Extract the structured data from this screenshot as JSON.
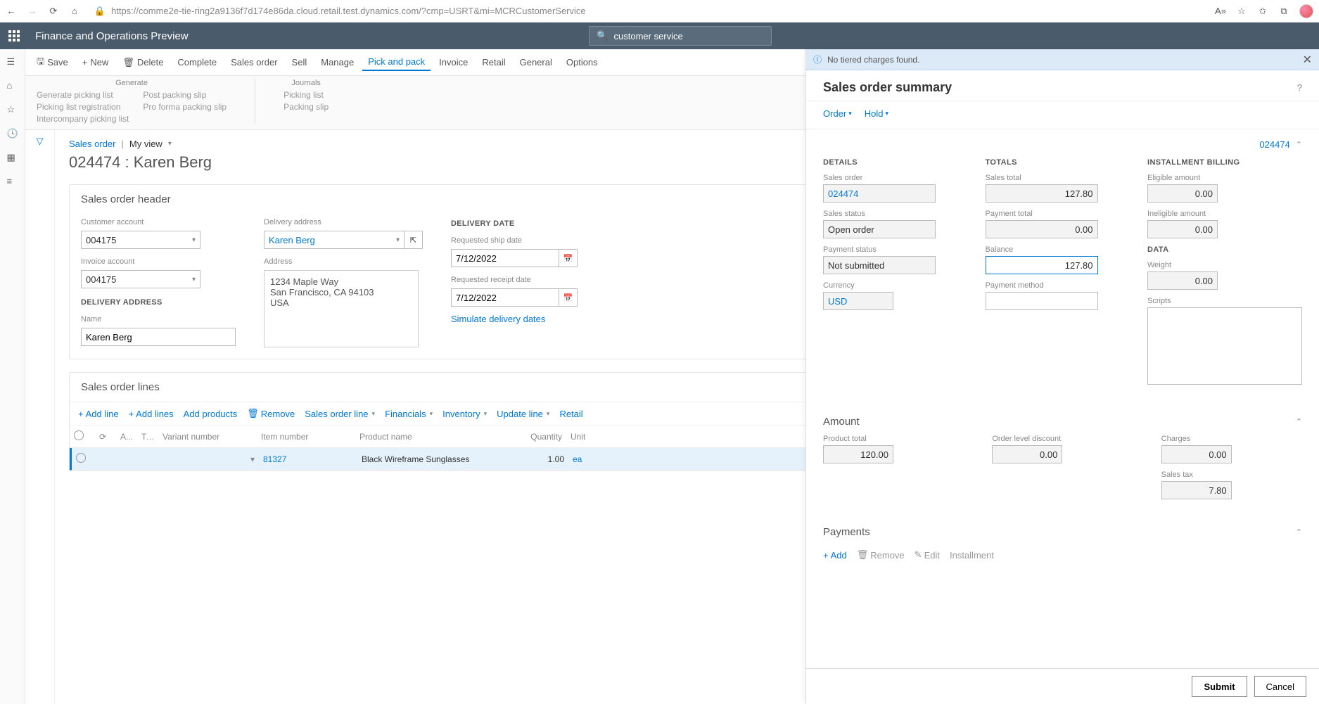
{
  "browser": {
    "url": "https://comme2e-tie-ring2a9136f7d174e86da.cloud.retail.test.dynamics.com/?cmp=USRT&mi=MCRCustomerService"
  },
  "header": {
    "app_title": "Finance and Operations Preview",
    "search_value": "customer service"
  },
  "toolbar": {
    "save": "Save",
    "new": "New",
    "delete": "Delete",
    "complete": "Complete",
    "sales_order": "Sales order",
    "sell": "Sell",
    "manage": "Manage",
    "pick_pack": "Pick and pack",
    "invoice": "Invoice",
    "retail": "Retail",
    "general": "General",
    "options": "Options"
  },
  "subtoolbar": {
    "generate": {
      "title": "Generate",
      "col1": [
        "Generate picking list",
        "Picking list registration",
        "Intercompany picking list"
      ],
      "col2": [
        "Post packing slip",
        "Pro forma packing slip"
      ]
    },
    "journals": {
      "title": "Journals",
      "items": [
        "Picking list",
        "Packing slip"
      ]
    }
  },
  "breadcrumb": {
    "link": "Sales order",
    "myview": "My view"
  },
  "page": {
    "title": "024474 : Karen Berg",
    "header_title": "Sales order header",
    "lines_title": "Sales order lines"
  },
  "form": {
    "customer_account_label": "Customer account",
    "customer_account": "004175",
    "invoice_account_label": "Invoice account",
    "invoice_account": "004175",
    "delivery_address_sec": "DELIVERY ADDRESS",
    "name_label": "Name",
    "name": "Karen Berg",
    "delivery_address_label": "Delivery address",
    "delivery_address": "Karen Berg",
    "address_label": "Address",
    "address_text": "1234 Maple Way\nSan Francisco, CA 94103\nUSA",
    "delivery_date_sec": "DELIVERY DATE",
    "req_ship_label": "Requested ship date",
    "req_ship": "7/12/2022",
    "req_receipt_label": "Requested receipt date",
    "req_receipt": "7/12/2022",
    "simulate": "Simulate delivery dates"
  },
  "lines_toolbar": {
    "add_line": "Add line",
    "add_lines": "Add lines",
    "add_products": "Add products",
    "remove": "Remove",
    "sales_order_line": "Sales order line",
    "financials": "Financials",
    "inventory": "Inventory",
    "update_line": "Update line",
    "retail": "Retail"
  },
  "grid": {
    "cols": {
      "a": "A...",
      "ty": "Ty...",
      "variant": "Variant number",
      "item": "Item number",
      "product": "Product name",
      "qty": "Quantity",
      "unit": "Unit"
    },
    "rows": [
      {
        "item": "81327",
        "product": "Black Wireframe Sunglasses",
        "qty": "1.00",
        "unit": "ea"
      }
    ]
  },
  "side": {
    "info_msg": "No tiered charges found.",
    "title": "Sales order summary",
    "actions": {
      "order": "Order",
      "hold": "Hold"
    },
    "order_link": "024474",
    "details": {
      "head": "DETAILS",
      "sales_order_label": "Sales order",
      "sales_order": "024474",
      "sales_status_label": "Sales status",
      "sales_status": "Open order",
      "payment_status_label": "Payment status",
      "payment_status": "Not submitted",
      "currency_label": "Currency",
      "currency": "USD"
    },
    "totals": {
      "head": "TOTALS",
      "sales_total_label": "Sales total",
      "sales_total": "127.80",
      "payment_total_label": "Payment total",
      "payment_total": "0.00",
      "balance_label": "Balance",
      "balance": "127.80",
      "payment_method_label": "Payment method",
      "payment_method": ""
    },
    "installment": {
      "head": "INSTALLMENT BILLING",
      "eligible_label": "Eligible amount",
      "eligible": "0.00",
      "ineligible_label": "Ineligible amount",
      "ineligible": "0.00",
      "data_head": "DATA",
      "weight_label": "Weight",
      "weight": "0.00",
      "scripts_label": "Scripts"
    },
    "amount": {
      "title": "Amount",
      "product_total_label": "Product total",
      "product_total": "120.00",
      "discount_label": "Order level discount",
      "discount": "0.00",
      "charges_label": "Charges",
      "charges": "0.00",
      "tax_label": "Sales tax",
      "tax": "7.80"
    },
    "payments": {
      "title": "Payments",
      "add": "Add",
      "remove": "Remove",
      "edit": "Edit",
      "installment": "Installment"
    },
    "footer": {
      "submit": "Submit",
      "cancel": "Cancel"
    }
  }
}
